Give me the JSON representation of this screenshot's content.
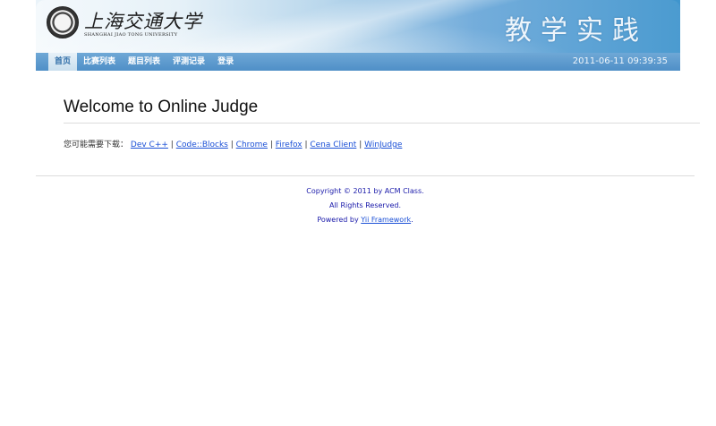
{
  "header": {
    "logo_cn": "上海交通大学",
    "logo_en": "SHANGHAI JIAO TONG UNIVERSITY",
    "site_title": "教学实践",
    "datetime": "2011-06-11 09:39:35"
  },
  "nav": {
    "items": [
      {
        "label": "首页",
        "active": true
      },
      {
        "label": "比赛列表",
        "active": false
      },
      {
        "label": "题目列表",
        "active": false
      },
      {
        "label": "评测记录",
        "active": false
      },
      {
        "label": "登录",
        "active": false
      }
    ]
  },
  "main": {
    "title": "Welcome to Online Judge",
    "download_prefix": "您可能需要下载：",
    "downloads": [
      "Dev C++",
      "Code::Blocks",
      "Chrome",
      "Firefox",
      "Cena Client",
      "WinJudge"
    ]
  },
  "footer": {
    "copyright": "Copyright © 2011 by ACM Class.",
    "rights": "All Rights Reserved.",
    "powered_prefix": "Powered by ",
    "powered_link": "Yii Framework",
    "powered_suffix": "."
  }
}
